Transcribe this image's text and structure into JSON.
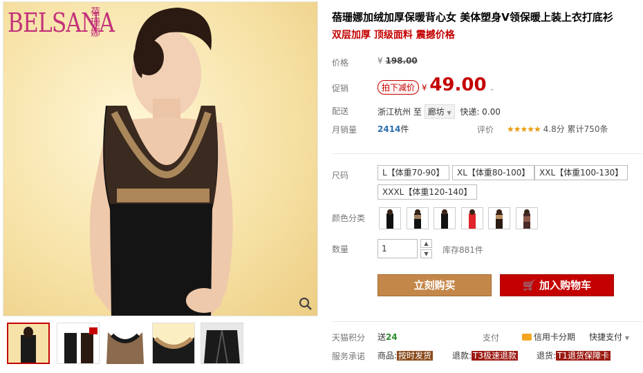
{
  "brand": {
    "logo_text": "BELSANA",
    "logo_cn": "蓓珊娜"
  },
  "product": {
    "title": "蓓珊娜加绒加厚保暖背心女 美体塑身V领保暖上装上衣打底衫",
    "subtitle": "双层加厚 顶级面料 震撼价格"
  },
  "price": {
    "label": "价格",
    "currency": "¥",
    "original": "198.00"
  },
  "promo": {
    "label": "促销",
    "tag": "拍下减价",
    "currency": "¥",
    "price": "49.00"
  },
  "shipping": {
    "label": "配送",
    "from": "浙江杭州",
    "to_word": "至",
    "destination": "廊坊",
    "express": "快递: 0.00"
  },
  "sales": {
    "label": "月销量",
    "count": "2414",
    "unit": "件",
    "review_label": "评价",
    "stars": "★★★★★",
    "score": "4.8分",
    "review_total": "累计750条"
  },
  "size": {
    "label": "尺码",
    "options": [
      "L【体重70-90】",
      "XL【体重80-100】",
      "XXL【体重100-130】",
      "XXXL【体重120-140】"
    ]
  },
  "color": {
    "label": "颜色分类"
  },
  "quantity": {
    "label": "数量",
    "value": "1",
    "stock": "库存881件"
  },
  "buttons": {
    "buy": "立刻购买",
    "cart": "加入购物车"
  },
  "points": {
    "label": "天猫积分",
    "send": "送",
    "value": "24",
    "pay_label": "支付",
    "credit": "信用卡分期",
    "quick": "快捷支付"
  },
  "promise": {
    "label": "服务承诺",
    "goods_label": "商品:",
    "goods_tag": "按时发货",
    "refund_label": "退款:",
    "refund_tag": "T3极速退款",
    "return_label": "退货:",
    "return_tag": "T1退货保障卡"
  },
  "colors": {
    "accent": "#c40000",
    "buy_button": "#c4874a",
    "logo": "#c2327a"
  }
}
